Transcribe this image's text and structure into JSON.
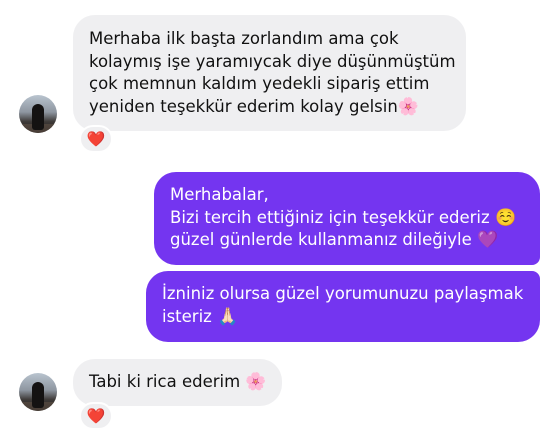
{
  "messages": [
    {
      "lines": [
        "Merhaba ilk başta zorlandım ama çok",
        "kolaymış işe yaramıycak diye düşünmüştüm",
        "çok memnun kaldım yedekli sipariş ettim",
        "yeniden teşekkür ederim kolay gelsin"
      ],
      "trailing_emoji": "🌸",
      "reaction": "❤️"
    },
    {
      "lines": [
        "Merhabalar,",
        "Bizi tercih ettiğiniz için teşekkür ederiz",
        "güzel günlerde kullanmanız dileğiyle"
      ],
      "emoji_line2": "☺️",
      "emoji_line3": "💜"
    },
    {
      "lines": [
        "İzniniz olursa güzel yorumunuzu paylaşmak",
        "isteriz"
      ],
      "emoji_line2": "🙏🏻"
    },
    {
      "text": "Tabi ki rica ederim",
      "trailing_emoji": "🌸",
      "reaction": "❤️"
    }
  ],
  "colors": {
    "incoming_bubble": "#efeff1",
    "outgoing_bubble": "#7435f0",
    "reaction_heart": "#e8253b"
  }
}
